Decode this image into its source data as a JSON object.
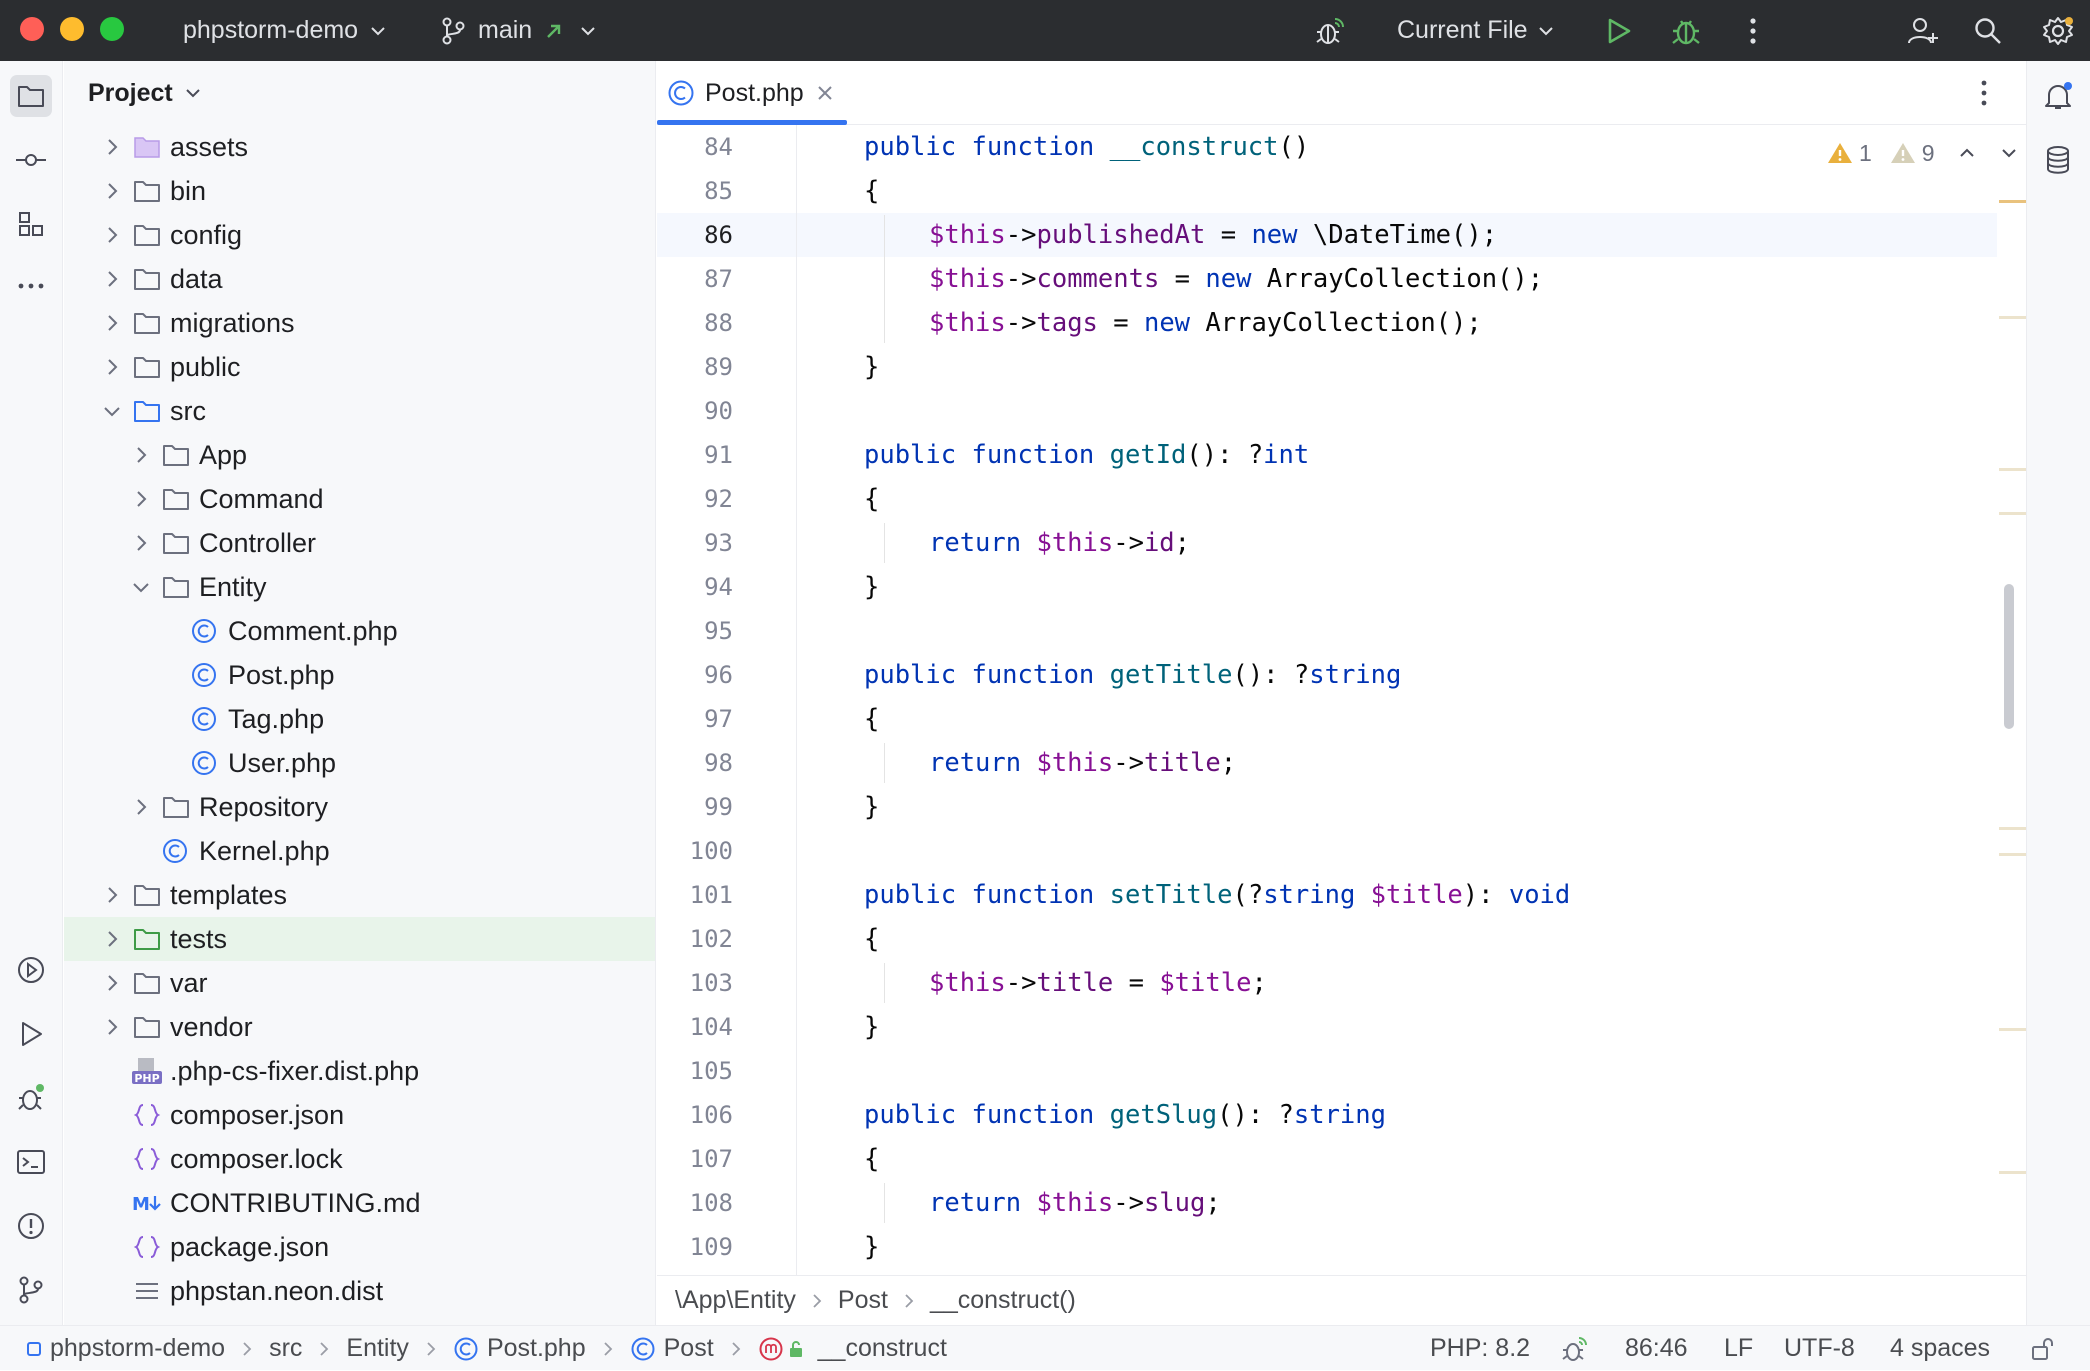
{
  "titlebar": {
    "project_name": "phpstorm-demo",
    "branch": "main",
    "run_config": "Current File"
  },
  "project_panel": {
    "title": "Project",
    "tree": [
      {
        "label": "assets",
        "depth": 0,
        "type": "folder-special",
        "expanded": false
      },
      {
        "label": "bin",
        "depth": 0,
        "type": "folder",
        "expanded": false
      },
      {
        "label": "config",
        "depth": 0,
        "type": "folder",
        "expanded": false
      },
      {
        "label": "data",
        "depth": 0,
        "type": "folder",
        "expanded": false
      },
      {
        "label": "migrations",
        "depth": 0,
        "type": "folder",
        "expanded": false
      },
      {
        "label": "public",
        "depth": 0,
        "type": "folder",
        "expanded": false
      },
      {
        "label": "src",
        "depth": 0,
        "type": "folder-source",
        "expanded": true
      },
      {
        "label": "App",
        "depth": 1,
        "type": "folder",
        "expanded": false
      },
      {
        "label": "Command",
        "depth": 1,
        "type": "folder",
        "expanded": false
      },
      {
        "label": "Controller",
        "depth": 1,
        "type": "folder",
        "expanded": false
      },
      {
        "label": "Entity",
        "depth": 1,
        "type": "folder",
        "expanded": true
      },
      {
        "label": "Comment.php",
        "depth": 2,
        "type": "php-class"
      },
      {
        "label": "Post.php",
        "depth": 2,
        "type": "php-class"
      },
      {
        "label": "Tag.php",
        "depth": 2,
        "type": "php-class"
      },
      {
        "label": "User.php",
        "depth": 2,
        "type": "php-class"
      },
      {
        "label": "Repository",
        "depth": 1,
        "type": "folder",
        "expanded": false
      },
      {
        "label": "Kernel.php",
        "depth": 1,
        "type": "php-class"
      },
      {
        "label": "templates",
        "depth": 0,
        "type": "folder",
        "expanded": false
      },
      {
        "label": "tests",
        "depth": 0,
        "type": "folder-test",
        "expanded": false,
        "selected": true
      },
      {
        "label": "var",
        "depth": 0,
        "type": "folder",
        "expanded": false
      },
      {
        "label": "vendor",
        "depth": 0,
        "type": "folder",
        "expanded": false
      },
      {
        "label": ".php-cs-fixer.dist.php",
        "depth": 0,
        "type": "php-file"
      },
      {
        "label": "composer.json",
        "depth": 0,
        "type": "json"
      },
      {
        "label": "composer.lock",
        "depth": 0,
        "type": "json"
      },
      {
        "label": "CONTRIBUTING.md",
        "depth": 0,
        "type": "markdown"
      },
      {
        "label": "package.json",
        "depth": 0,
        "type": "json"
      },
      {
        "label": "phpstan.neon.dist",
        "depth": 0,
        "type": "text"
      }
    ]
  },
  "editor": {
    "tab_label": "Post.php",
    "warnings_error_count": "1",
    "warnings_weak_count": "9",
    "current_line": 86,
    "lines": [
      {
        "n": "84",
        "tokens": [
          [
            "kw",
            "public "
          ],
          [
            "kw",
            "function "
          ],
          [
            "fn",
            "__construct"
          ],
          [
            "plain",
            "()"
          ]
        ],
        "indent": 1
      },
      {
        "n": "85",
        "tokens": [
          [
            "plain",
            "{"
          ]
        ],
        "indent": 1
      },
      {
        "n": "86",
        "tokens": [
          [
            "this",
            "$this"
          ],
          [
            "plain",
            "->"
          ],
          [
            "var",
            "publishedAt"
          ],
          [
            "plain",
            " = "
          ],
          [
            "kw",
            "new "
          ],
          [
            "plain",
            "\\DateTime();"
          ]
        ],
        "indent": 2
      },
      {
        "n": "87",
        "tokens": [
          [
            "this",
            "$this"
          ],
          [
            "plain",
            "->"
          ],
          [
            "var",
            "comments"
          ],
          [
            "plain",
            " = "
          ],
          [
            "kw",
            "new "
          ],
          [
            "plain",
            "ArrayCollection();"
          ]
        ],
        "indent": 2
      },
      {
        "n": "88",
        "tokens": [
          [
            "this",
            "$this"
          ],
          [
            "plain",
            "->"
          ],
          [
            "var",
            "tags"
          ],
          [
            "plain",
            " = "
          ],
          [
            "kw",
            "new "
          ],
          [
            "plain",
            "ArrayCollection();"
          ]
        ],
        "indent": 2
      },
      {
        "n": "89",
        "tokens": [
          [
            "plain",
            "}"
          ]
        ],
        "indent": 1
      },
      {
        "n": "90",
        "tokens": [],
        "indent": 1
      },
      {
        "n": "91",
        "tokens": [
          [
            "kw",
            "public "
          ],
          [
            "kw",
            "function "
          ],
          [
            "fn",
            "getId"
          ],
          [
            "plain",
            "(): ?"
          ],
          [
            "tp",
            "int"
          ]
        ],
        "indent": 1
      },
      {
        "n": "92",
        "tokens": [
          [
            "plain",
            "{"
          ]
        ],
        "indent": 1
      },
      {
        "n": "93",
        "tokens": [
          [
            "kw",
            "return "
          ],
          [
            "this",
            "$this"
          ],
          [
            "plain",
            "->"
          ],
          [
            "var",
            "id"
          ],
          [
            "plain",
            ";"
          ]
        ],
        "indent": 2
      },
      {
        "n": "94",
        "tokens": [
          [
            "plain",
            "}"
          ]
        ],
        "indent": 1
      },
      {
        "n": "95",
        "tokens": [],
        "indent": 1
      },
      {
        "n": "96",
        "tokens": [
          [
            "kw",
            "public "
          ],
          [
            "kw",
            "function "
          ],
          [
            "fn",
            "getTitle"
          ],
          [
            "plain",
            "(): ?"
          ],
          [
            "tp",
            "string"
          ]
        ],
        "indent": 1
      },
      {
        "n": "97",
        "tokens": [
          [
            "plain",
            "{"
          ]
        ],
        "indent": 1
      },
      {
        "n": "98",
        "tokens": [
          [
            "kw",
            "return "
          ],
          [
            "this",
            "$this"
          ],
          [
            "plain",
            "->"
          ],
          [
            "var",
            "title"
          ],
          [
            "plain",
            ";"
          ]
        ],
        "indent": 2
      },
      {
        "n": "99",
        "tokens": [
          [
            "plain",
            "}"
          ]
        ],
        "indent": 1
      },
      {
        "n": "100",
        "tokens": [],
        "indent": 1
      },
      {
        "n": "101",
        "tokens": [
          [
            "kw",
            "public "
          ],
          [
            "kw",
            "function "
          ],
          [
            "fn",
            "setTitle"
          ],
          [
            "plain",
            "(?"
          ],
          [
            "tp",
            "string "
          ],
          [
            "this",
            "$title"
          ],
          [
            "plain",
            "): "
          ],
          [
            "tp",
            "void"
          ]
        ],
        "indent": 1
      },
      {
        "n": "102",
        "tokens": [
          [
            "plain",
            "{"
          ]
        ],
        "indent": 1
      },
      {
        "n": "103",
        "tokens": [
          [
            "this",
            "$this"
          ],
          [
            "plain",
            "->"
          ],
          [
            "var",
            "title"
          ],
          [
            "plain",
            " = "
          ],
          [
            "this",
            "$title"
          ],
          [
            "plain",
            ";"
          ]
        ],
        "indent": 2
      },
      {
        "n": "104",
        "tokens": [
          [
            "plain",
            "}"
          ]
        ],
        "indent": 1
      },
      {
        "n": "105",
        "tokens": [],
        "indent": 1
      },
      {
        "n": "106",
        "tokens": [
          [
            "kw",
            "public "
          ],
          [
            "kw",
            "function "
          ],
          [
            "fn",
            "getSlug"
          ],
          [
            "plain",
            "(): ?"
          ],
          [
            "tp",
            "string"
          ]
        ],
        "indent": 1
      },
      {
        "n": "107",
        "tokens": [
          [
            "plain",
            "{"
          ]
        ],
        "indent": 1
      },
      {
        "n": "108",
        "tokens": [
          [
            "kw",
            "return "
          ],
          [
            "this",
            "$this"
          ],
          [
            "plain",
            "->"
          ],
          [
            "var",
            "slug"
          ],
          [
            "plain",
            ";"
          ]
        ],
        "indent": 2
      },
      {
        "n": "109",
        "tokens": [
          [
            "plain",
            "}"
          ]
        ],
        "indent": 1
      }
    ],
    "breadcrumbs": [
      "\\App\\Entity",
      "Post",
      "__construct()"
    ]
  },
  "statusbar": {
    "path": [
      "phpstorm-demo",
      "src",
      "Entity",
      "Post.php",
      "Post",
      "__construct"
    ],
    "php_version": "PHP: 8.2",
    "caret": "86:46",
    "line_sep": "LF",
    "encoding": "UTF-8",
    "indent": "4 spaces"
  },
  "colors": {
    "accent": "#3574f0",
    "titlebar_bg": "#2b2d30",
    "run_green": "#5fb865",
    "warning_yellow": "#e9b03d"
  }
}
